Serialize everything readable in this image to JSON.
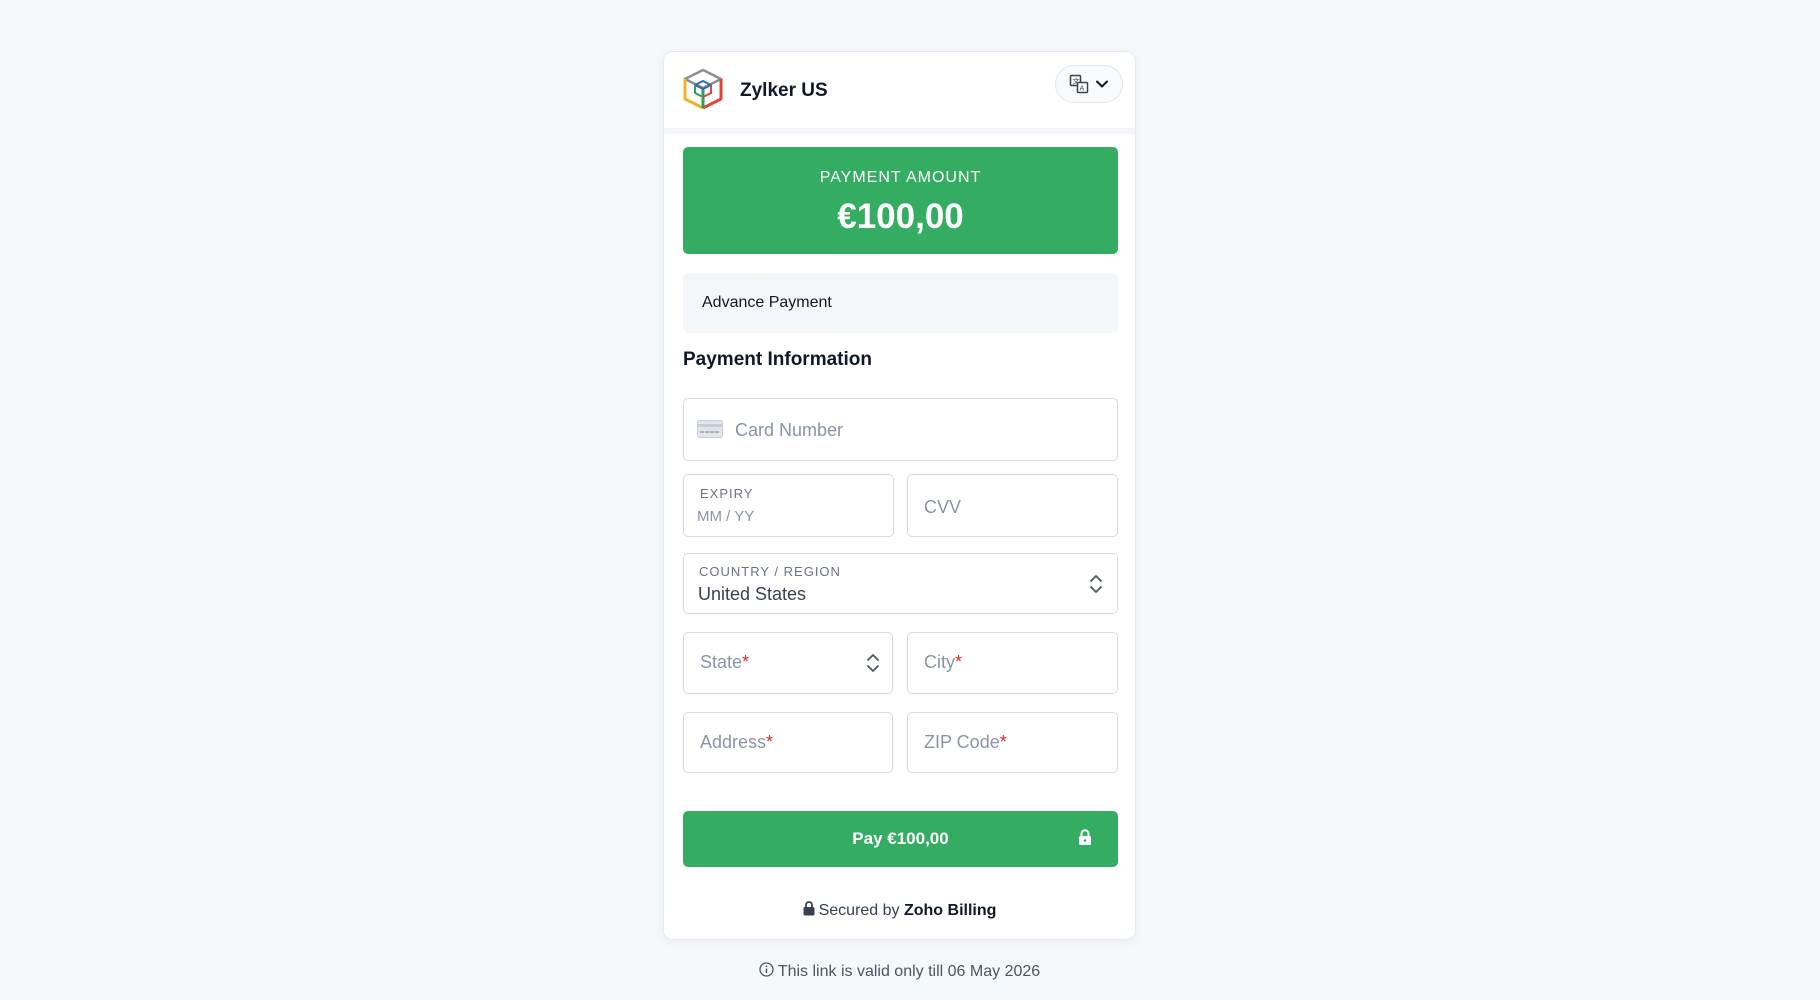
{
  "header": {
    "brand": "Zylker US",
    "logo_icon": "cube-icon",
    "language_icon": "translate-icon"
  },
  "amount": {
    "label": "PAYMENT AMOUNT",
    "value": "€100,00"
  },
  "description": "Advance Payment",
  "section_title": "Payment Information",
  "form": {
    "card_number_placeholder": "Card Number",
    "expiry_label": "EXPIRY",
    "expiry_placeholder": "MM / YY",
    "cvv_placeholder": "CVV",
    "country_label": "COUNTRY / REGION",
    "country_value": "United States",
    "state_placeholder": "State",
    "city_placeholder": "City",
    "address_placeholder": "Address",
    "zip_placeholder": "ZIP Code",
    "required_mark": "*"
  },
  "pay_button": {
    "label": "Pay €100,00"
  },
  "footer": {
    "secured_prefix": "Secured by",
    "secured_brand": "Zoho Billing",
    "validity": "This link is valid only till 06 May 2026"
  },
  "colors": {
    "accent": "#34ad63",
    "background": "#f6f9fc",
    "required": "#dc2626"
  }
}
